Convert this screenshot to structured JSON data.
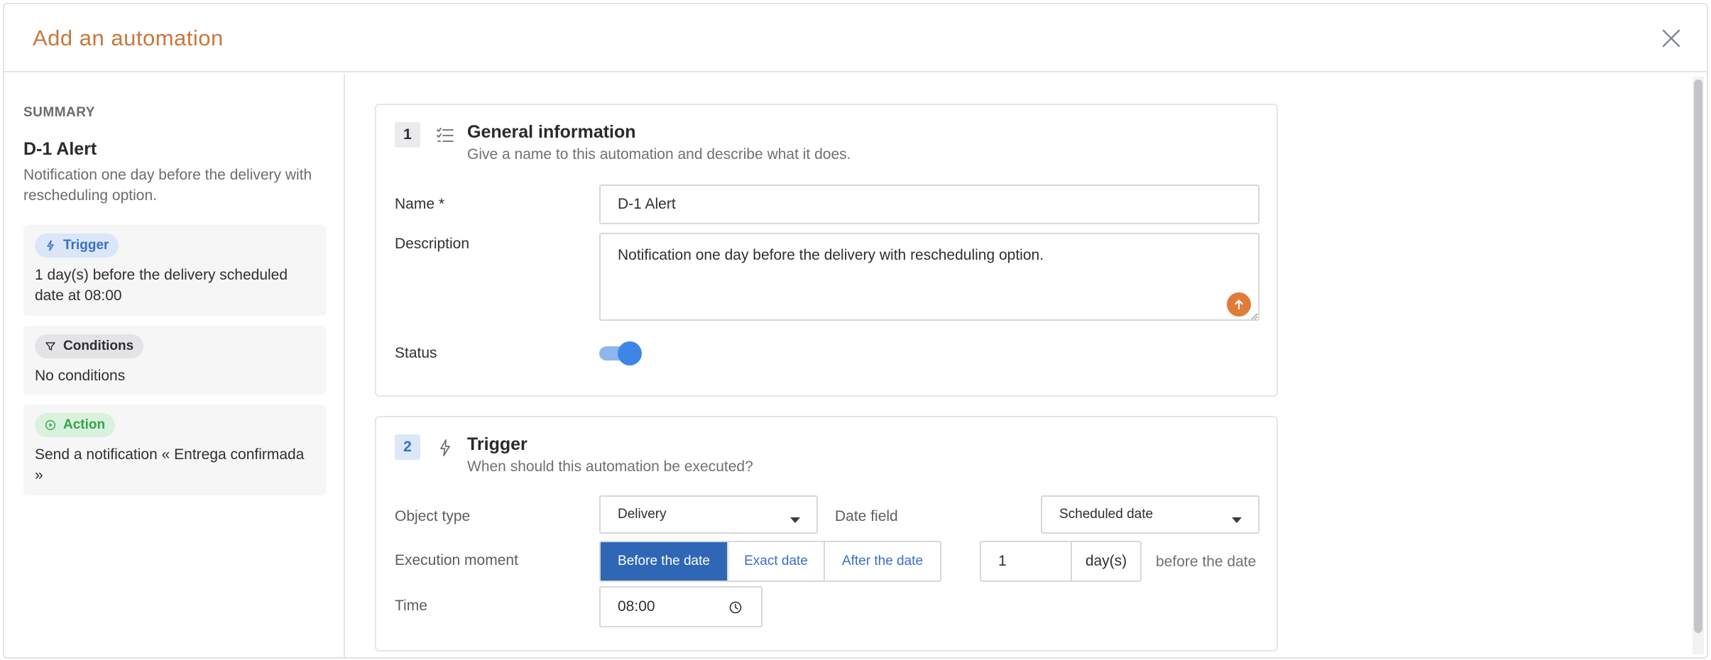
{
  "modal": {
    "title": "Add an automation",
    "close_icon": "close-icon"
  },
  "summary": {
    "label": "SUMMARY",
    "name": "D-1 Alert",
    "description": "Notification one day before the delivery with rescheduling option.",
    "trigger": {
      "pill_label": "Trigger",
      "icon": "lightning-icon",
      "text": "1 day(s) before the delivery scheduled date at 08:00"
    },
    "conditions": {
      "pill_label": "Conditions",
      "icon": "filter-icon",
      "text": "No conditions"
    },
    "action": {
      "pill_label": "Action",
      "icon": "play-circle-icon",
      "text": "Send a notification « Entrega confirmada »"
    }
  },
  "general": {
    "step": "1",
    "icon": "checklist-icon",
    "title": "General information",
    "subtitle": "Give a name to this automation and describe what it does.",
    "name_label": "Name *",
    "name_value": "D-1 Alert",
    "description_label": "Description",
    "description_value": "Notification one day before the delivery with rescheduling option.",
    "status_label": "Status",
    "status_on": true
  },
  "trigger_section": {
    "step": "2",
    "icon": "lightning-icon",
    "title": "Trigger",
    "subtitle": "When should this automation be executed?",
    "object_type_label": "Object type",
    "object_type_value": "Delivery",
    "date_field_label": "Date field",
    "date_field_value": "Scheduled date",
    "execution_label": "Execution moment",
    "execution_options": [
      "Before the date",
      "Exact date",
      "After the date"
    ],
    "execution_selected": "Before the date",
    "offset_value": "1",
    "offset_unit": "day(s)",
    "offset_suffix": "before the date",
    "time_label": "Time",
    "time_value": "08:00"
  },
  "colors": {
    "title_accent": "#c9773c",
    "primary_blue": "#2f66b5",
    "toggle_blue": "#3d86e6",
    "action_green": "#36a14f",
    "fab_orange": "#e07b3a"
  }
}
